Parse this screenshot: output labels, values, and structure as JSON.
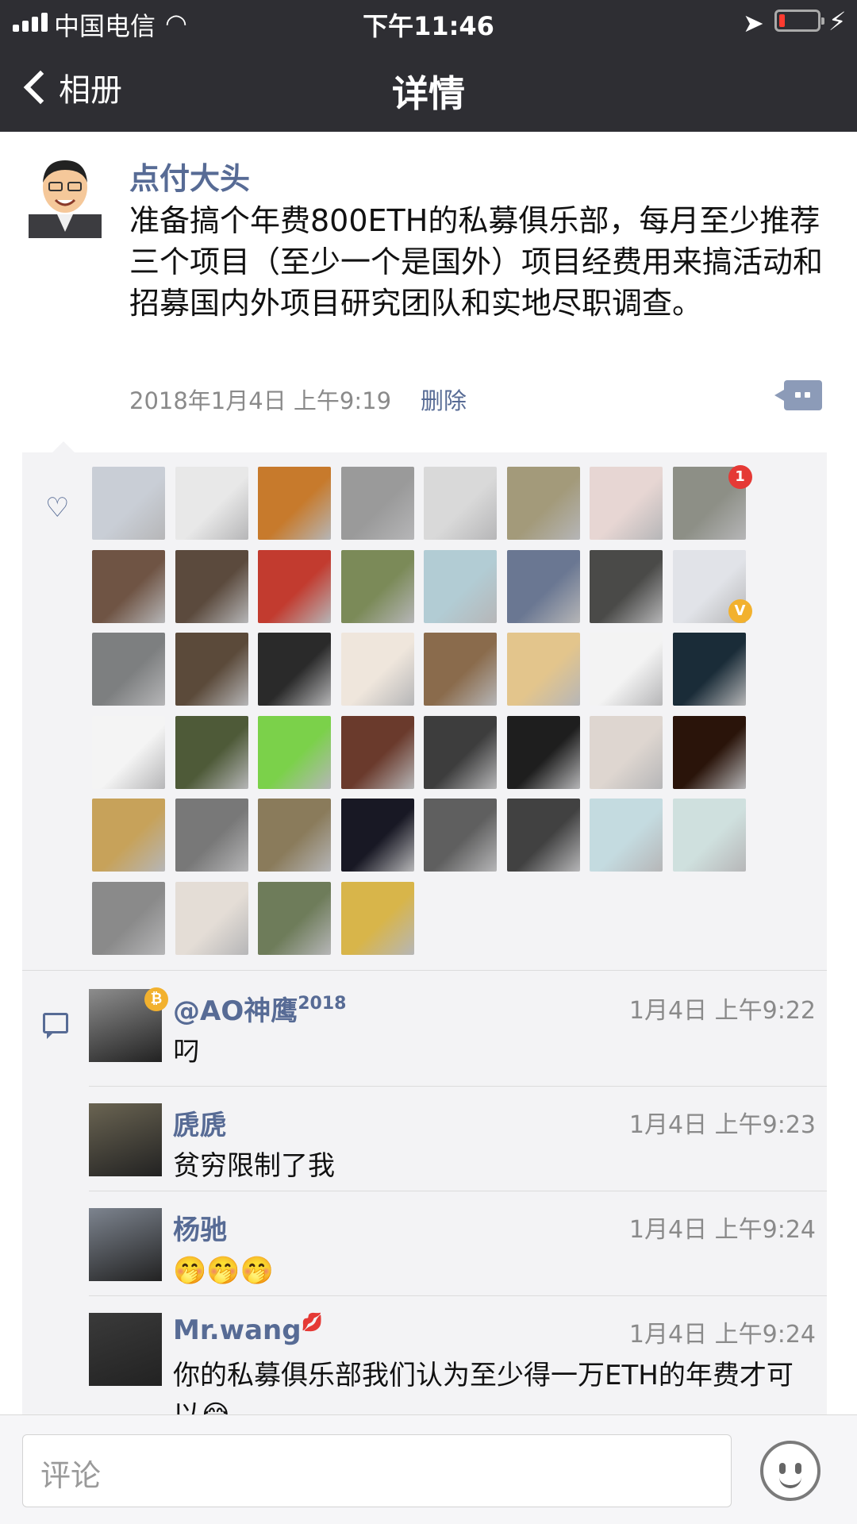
{
  "status_bar": {
    "carrier": "中国电信",
    "time": "下午11:46"
  },
  "nav": {
    "back_label": "相册",
    "title": "详情"
  },
  "post": {
    "author": "点付大头",
    "text": "准备搞个年费800ETH的私募俱乐部，每月至少推荐三个项目（至少一个是国外）项目经费用来搞活动和招募国内外项目研究团队和实地尽职调查。",
    "date": "2018年1月4日 上午9:19",
    "delete_label": "删除"
  },
  "likes": {
    "avatars": [
      {
        "name": "white-car-avatar",
        "color": "#c9ced6"
      },
      {
        "name": "crane-logo-avatar",
        "color": "#e8e8e8"
      },
      {
        "name": "sunset-avatar",
        "color": "#c77a2c"
      },
      {
        "name": "man-portrait-avatar",
        "color": "#9a9a9a"
      },
      {
        "name": "man-white-shirt-avatar",
        "color": "#d9d9d9"
      },
      {
        "name": "vintage-photo-avatar",
        "color": "#a39a7a"
      },
      {
        "name": "woman-portrait-avatar",
        "color": "#e7d6d3"
      },
      {
        "name": "jeep-avatar",
        "color": "#8d8f86",
        "badge": "1"
      },
      {
        "name": "woman-short-hair-avatar",
        "color": "#6f5444"
      },
      {
        "name": "group-meeting-avatar",
        "color": "#5b4a3d"
      },
      {
        "name": "conference-avatar",
        "color": "#c23b2f"
      },
      {
        "name": "tree-lane-avatar",
        "color": "#7b8a58"
      },
      {
        "name": "beach-avatar",
        "color": "#b2ccd4"
      },
      {
        "name": "couple-avatar",
        "color": "#6a7792"
      },
      {
        "name": "man-selfie-avatar",
        "color": "#4a4a48"
      },
      {
        "name": "man-suit-avatar",
        "color": "#e1e3e8",
        "badge": "V"
      },
      {
        "name": "guitar-man-avatar",
        "color": "#7d7f80"
      },
      {
        "name": "man-laptop-avatar",
        "color": "#5b4a3a"
      },
      {
        "name": "typography-avatar",
        "color": "#2a2a2a"
      },
      {
        "name": "buddha-avatar",
        "color": "#efe6dc"
      },
      {
        "name": "teddy-bear-avatar",
        "color": "#8a6b4c"
      },
      {
        "name": "young-man-avatar",
        "color": "#e3c58c"
      },
      {
        "name": "calligraphy-avatar",
        "color": "#f3f3f3"
      },
      {
        "name": "qb-wallet-avatar",
        "color": "#1a2c38"
      },
      {
        "name": "cartoon-man-avatar",
        "color": "#f4f4f4"
      },
      {
        "name": "military-vehicle-avatar",
        "color": "#4e5a38"
      },
      {
        "name": "snail-cartoon-avatar",
        "color": "#7bd14a"
      },
      {
        "name": "cat-avatar",
        "color": "#6a3a2c"
      },
      {
        "name": "hulk-silhouette-avatar",
        "color": "#3d3d3d"
      },
      {
        "name": "vendetta-avatar",
        "color": "#1e1e1e"
      },
      {
        "name": "girl-avatar",
        "color": "#ded6d0"
      },
      {
        "name": "fire-avatar",
        "color": "#2a140a"
      },
      {
        "name": "candy-avatar",
        "color": "#c7a25a"
      },
      {
        "name": "men-suits-avatar",
        "color": "#787878"
      },
      {
        "name": "fruit-seller-avatar",
        "color": "#8a7b5b"
      },
      {
        "name": "night-city-avatar",
        "color": "#181824"
      },
      {
        "name": "bearded-man-avatar",
        "color": "#5f5f5f"
      },
      {
        "name": "man-cap-avatar",
        "color": "#414141"
      },
      {
        "name": "cartoon-kid-avatar",
        "color": "#c4dbe0"
      },
      {
        "name": "starfish-avatar",
        "color": "#cfe0de"
      },
      {
        "name": "man-car-avatar",
        "color": "#8a8a8a"
      },
      {
        "name": "wood-texture-avatar",
        "color": "#e4ddd6"
      },
      {
        "name": "man-park-avatar",
        "color": "#6e7c5a"
      },
      {
        "name": "saudi-avatar",
        "color": "#d8b54a"
      }
    ]
  },
  "comments": [
    {
      "name": "@AO神鹰",
      "name_sup": "2018",
      "time": "1月4日 上午9:22",
      "text": "叼",
      "avatar_color": "#8d8d8d",
      "badge": "₿"
    },
    {
      "name": "虒虒",
      "name_sup": "",
      "time": "1月4日 上午9:23",
      "text": "贫穷限制了我",
      "avatar_color": "#6a6452"
    },
    {
      "name": "杨驰",
      "name_sup": "",
      "time": "1月4日 上午9:24",
      "text": "🤭🤭🤭",
      "avatar_color": "#7d848f"
    },
    {
      "name": "Mr.wang",
      "name_sup": "💋",
      "time": "1月4日 上午9:24",
      "text": "你的私募俱乐部我们认为至少得一万ETH的年费才可以😂",
      "avatar_color": "#3a3a3a"
    }
  ],
  "input": {
    "placeholder": "评论"
  },
  "colors": {
    "nav_bg": "#2e2e33",
    "link": "#576b95",
    "box_bg": "#f3f3f5"
  }
}
